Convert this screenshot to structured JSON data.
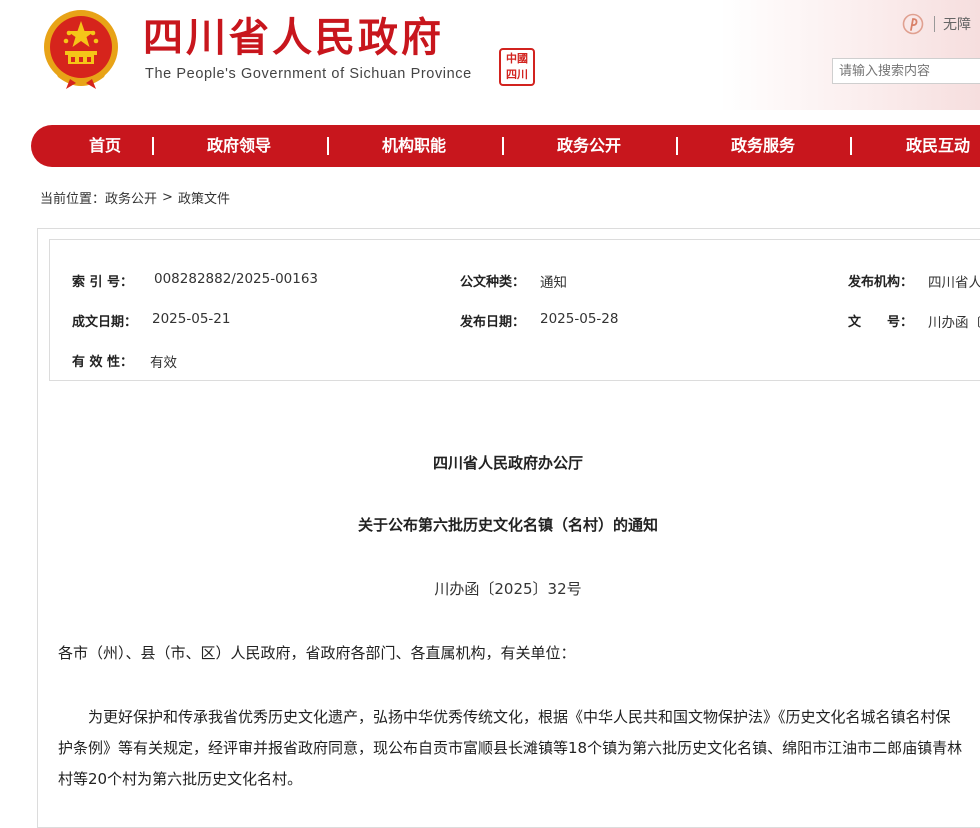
{
  "header": {
    "title": "四川省人民政府",
    "subtitle": "The People's Government of Sichuan Province",
    "seal_text": "中國四川",
    "accessibility_label": "无障",
    "search_placeholder": "请输入搜索内容"
  },
  "nav": {
    "items": [
      {
        "label": "首页"
      },
      {
        "label": "政府领导"
      },
      {
        "label": "机构职能"
      },
      {
        "label": "政务公开"
      },
      {
        "label": "政务服务"
      },
      {
        "label": "政民互动"
      }
    ],
    "separator": "|"
  },
  "breadcrumb": {
    "prefix": "当前位置：",
    "items": [
      "政务公开",
      "政策文件"
    ],
    "arrow": ">"
  },
  "meta": {
    "index_label": "索 引 号：",
    "index_value": "008282882/2025-00163",
    "doc_type_label": "公文种类：",
    "doc_type_value": "通知",
    "issuer_label": "发布机构：",
    "issuer_value": "四川省人",
    "created_label": "成文日期：",
    "created_value": "2025-05-21",
    "published_label": "发布日期：",
    "published_value": "2025-05-28",
    "docnum_label": "文　　号：",
    "docnum_value": "川办函〔",
    "validity_label": "有 效 性：",
    "validity_value": "有效"
  },
  "document": {
    "issuer": "四川省人民政府办公厅",
    "title": "关于公布第六批历史文化名镇（名村）的通知",
    "number": "川办函〔2025〕32号",
    "salutation": "各市（州）、县（市、区）人民政府，省政府各部门、各直属机构，有关单位：",
    "paragraph": "为更好保护和传承我省优秀历史文化遗产，弘扬中华优秀传统文化，根据《中华人民共和国文物保护法》《历史文化名城名镇名村保护条例》等有关规定，经评审并报省政府同意，现公布自贡市富顺县长滩镇等18个镇为第六批历史文化名镇、绵阳市江油市二郎庙镇青林村等20个村为第六批历史文化名村。"
  },
  "colors": {
    "brand_red": "#c8161d",
    "emblem_gold": "#f5c518"
  }
}
